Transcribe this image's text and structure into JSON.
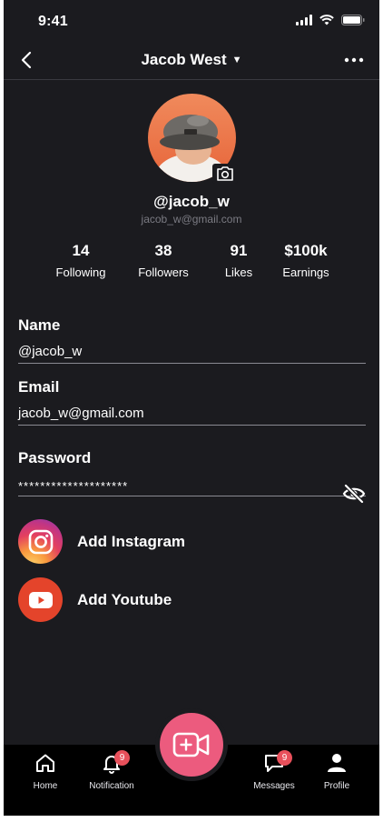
{
  "status_bar": {
    "time": "9:41"
  },
  "nav": {
    "title": "Jacob West"
  },
  "profile": {
    "username": "@jacob_w",
    "email": "jacob_w@gmail.com"
  },
  "stats": [
    {
      "value": "14",
      "label": "Following"
    },
    {
      "value": "38",
      "label": "Followers"
    },
    {
      "value": "91",
      "label": "Likes"
    },
    {
      "value": "$100k",
      "label": "Earnings"
    }
  ],
  "form": {
    "name": {
      "label": "Name",
      "value": "@jacob_w"
    },
    "email": {
      "label": "Email",
      "value": "jacob_w@gmail.com"
    },
    "password": {
      "label": "Password",
      "value": "********************"
    }
  },
  "social": {
    "instagram": {
      "label": "Add Instagram",
      "icon": "instagram-icon"
    },
    "youtube": {
      "label": "Add Youtube",
      "icon": "youtube-icon"
    }
  },
  "tabbar": {
    "home": {
      "label": "Home",
      "icon": "home-icon"
    },
    "notification": {
      "label": "Notification",
      "icon": "bell-icon",
      "badge": "9"
    },
    "messages": {
      "label": "Messages",
      "icon": "chat-icon",
      "badge": "9"
    },
    "profile": {
      "label": "Profile",
      "icon": "person-icon"
    },
    "record": {
      "icon": "video-add-icon"
    }
  },
  "colors": {
    "background": "#1b1b1f",
    "accent_pink": "#ec5b7e",
    "badge": "#e8505b",
    "youtube_red": "#e4442b",
    "muted_text": "#7b7b83"
  }
}
